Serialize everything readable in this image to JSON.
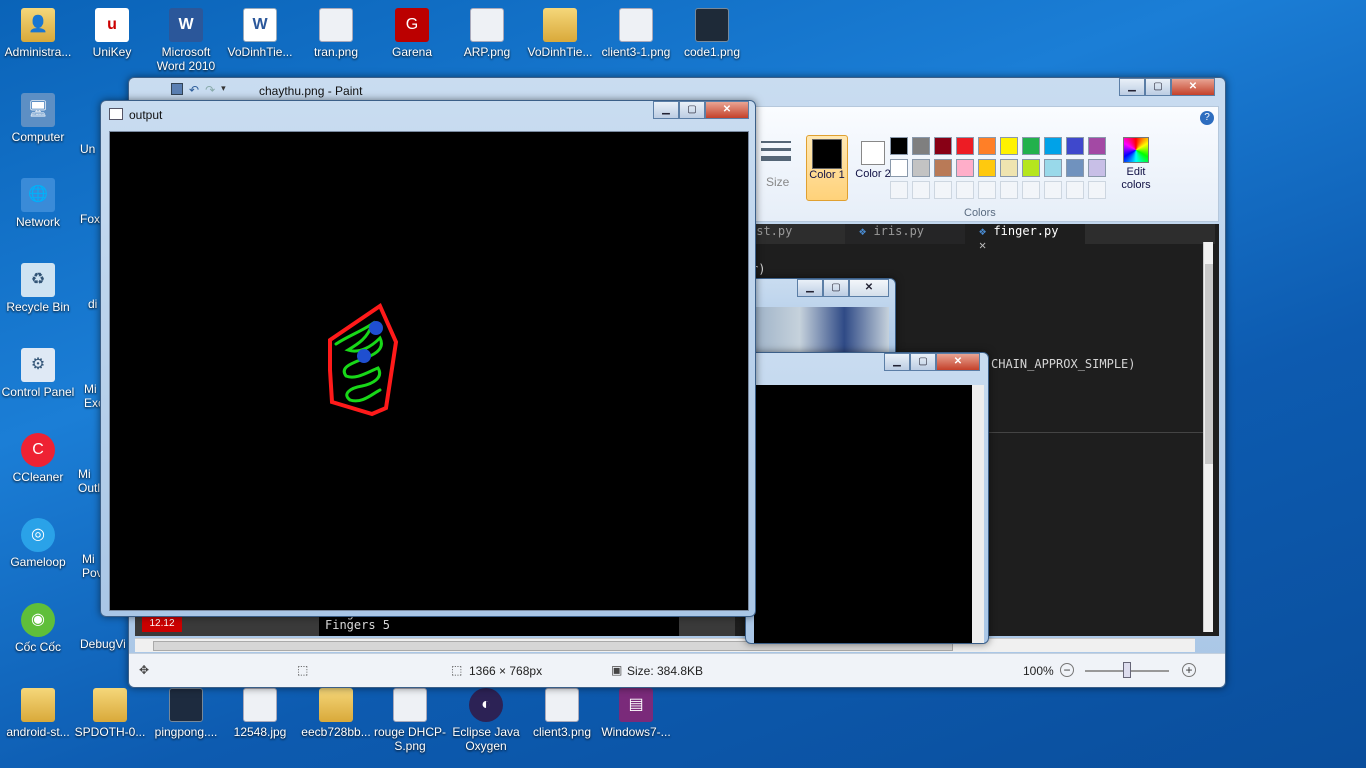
{
  "desktop": {
    "icons_top": [
      {
        "label": "Administra...",
        "icon": "user-folder-icon"
      },
      {
        "label": "UniKey",
        "icon": "unikey-icon"
      },
      {
        "label": "Microsoft Word 2010",
        "icon": "word-icon"
      },
      {
        "label": "VoDinhTie...",
        "icon": "word-doc-icon"
      },
      {
        "label": "tran.png",
        "icon": "image-icon"
      },
      {
        "label": "Garena",
        "icon": "garena-icon"
      },
      {
        "label": "ARP.png",
        "icon": "image-icon"
      },
      {
        "label": "VoDinhTie...",
        "icon": "folder-icon"
      },
      {
        "label": "client3-1.png",
        "icon": "image-icon"
      },
      {
        "label": "code1.png",
        "icon": "image-icon"
      }
    ],
    "icons_left": [
      {
        "label": "Computer",
        "icon": "computer-icon"
      },
      {
        "label": "Network",
        "icon": "network-icon"
      },
      {
        "label": "Recycle Bin",
        "icon": "recycle-bin-icon"
      },
      {
        "label": "Control Panel",
        "icon": "control-panel-icon"
      },
      {
        "label": "CCleaner",
        "icon": "ccleaner-icon"
      },
      {
        "label": "Gameloop",
        "icon": "gameloop-icon"
      },
      {
        "label": "Cốc Cốc",
        "icon": "coccoc-icon"
      }
    ],
    "icons_col2": [
      "Un",
      "Foxi",
      "di",
      "Mi Exc",
      "Mi Outl",
      "Mi Pov",
      "DebugVi"
    ],
    "icons_bottom": [
      {
        "label": "android-st...",
        "icon": "folder-icon"
      },
      {
        "label": "SPDOTH-0...",
        "icon": "folder-icon"
      },
      {
        "label": "pingpong....",
        "icon": "image-icon"
      },
      {
        "label": "12548.jpg",
        "icon": "image-icon"
      },
      {
        "label": "eecb728bb...",
        "icon": "folder-icon"
      },
      {
        "label": "rouge DHCP-S.png",
        "icon": "image-icon"
      },
      {
        "label": "Eclipse Java Oxygen",
        "icon": "eclipse-icon"
      },
      {
        "label": "client3.png",
        "icon": "image-icon"
      },
      {
        "label": "Windows7-...",
        "icon": "winrar-icon"
      }
    ]
  },
  "paint": {
    "title": "chaythu.png - Paint",
    "size_label": "Size",
    "color1": "Color 1",
    "color2": "Color 2",
    "edit_colors": "Edit colors",
    "colors_group": "Colors",
    "palette_row1": [
      "#000000",
      "#7f7f7f",
      "#880015",
      "#ed1c24",
      "#ff7f27",
      "#fff200",
      "#22b14c",
      "#00a2e8",
      "#3f48cc",
      "#a349a4"
    ],
    "palette_row2": [
      "#ffffff",
      "#c3c3c3",
      "#b97a57",
      "#ffaec9",
      "#ffc90e",
      "#efe4b0",
      "#b5e61d",
      "#99d9ea",
      "#7092be",
      "#c8bfe7"
    ],
    "status": {
      "dimensions": "1366 × 768px",
      "file_size": "Size: 384.8KB",
      "zoom": "100%"
    }
  },
  "editor": {
    "tabs": [
      "est.py",
      "iris.py",
      "finger.py"
    ],
    "line1": "r)",
    "line2": "CHAIN_APPROX_SIMPLE)"
  },
  "console": {
    "lines": [
      "Fingers 5",
      "Fingers 5"
    ]
  },
  "calendar_badge": "12.12",
  "output": {
    "title": "output"
  },
  "colors": {
    "contour_red": "#ff1a1a",
    "contour_green": "#18d818",
    "points_blue": "#1f4fd0"
  }
}
